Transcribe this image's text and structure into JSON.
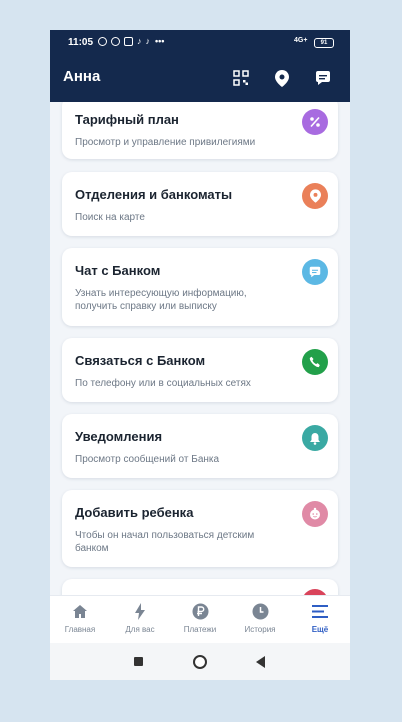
{
  "status_bar": {
    "time": "11:05",
    "network": "4G+",
    "battery": "91"
  },
  "header": {
    "title": "Анна"
  },
  "menu": [
    {
      "title": "Тарифный план",
      "subtitle": "Просмотр и управление привилегиями",
      "icon": "percent-icon",
      "color": "#a86be0"
    },
    {
      "title": "Отделения и банкоматы",
      "subtitle": "Поиск на карте",
      "icon": "location-pin-icon",
      "color": "#ea8059"
    },
    {
      "title": "Чат с Банком",
      "subtitle": "Узнать интересующую информацию, получить справку или выписку",
      "icon": "chat-icon",
      "color": "#5cb8e4"
    },
    {
      "title": "Связаться с Банком",
      "subtitle": "По телефону или в социальных сетях",
      "icon": "phone-icon",
      "color": "#22a04a"
    },
    {
      "title": "Уведомления",
      "subtitle": "Просмотр сообщений от Банка",
      "icon": "bell-icon",
      "color": "#3aa9a3"
    },
    {
      "title": "Добавить ребенка",
      "subtitle": "Чтобы он начал пользоваться детским банком",
      "icon": "baby-icon",
      "color": "#e08aa6"
    }
  ],
  "bottom_nav": [
    {
      "label": "Главная",
      "icon": "home-icon"
    },
    {
      "label": "Для вас",
      "icon": "lightning-icon"
    },
    {
      "label": "Платежи",
      "icon": "ruble-icon"
    },
    {
      "label": "История",
      "icon": "clock-icon"
    },
    {
      "label": "Ещё",
      "icon": "menu-icon",
      "active": true
    }
  ],
  "colors": {
    "header_bg": "#14294d",
    "accent": "#2f5ec4",
    "background": "#f2f5f9"
  }
}
